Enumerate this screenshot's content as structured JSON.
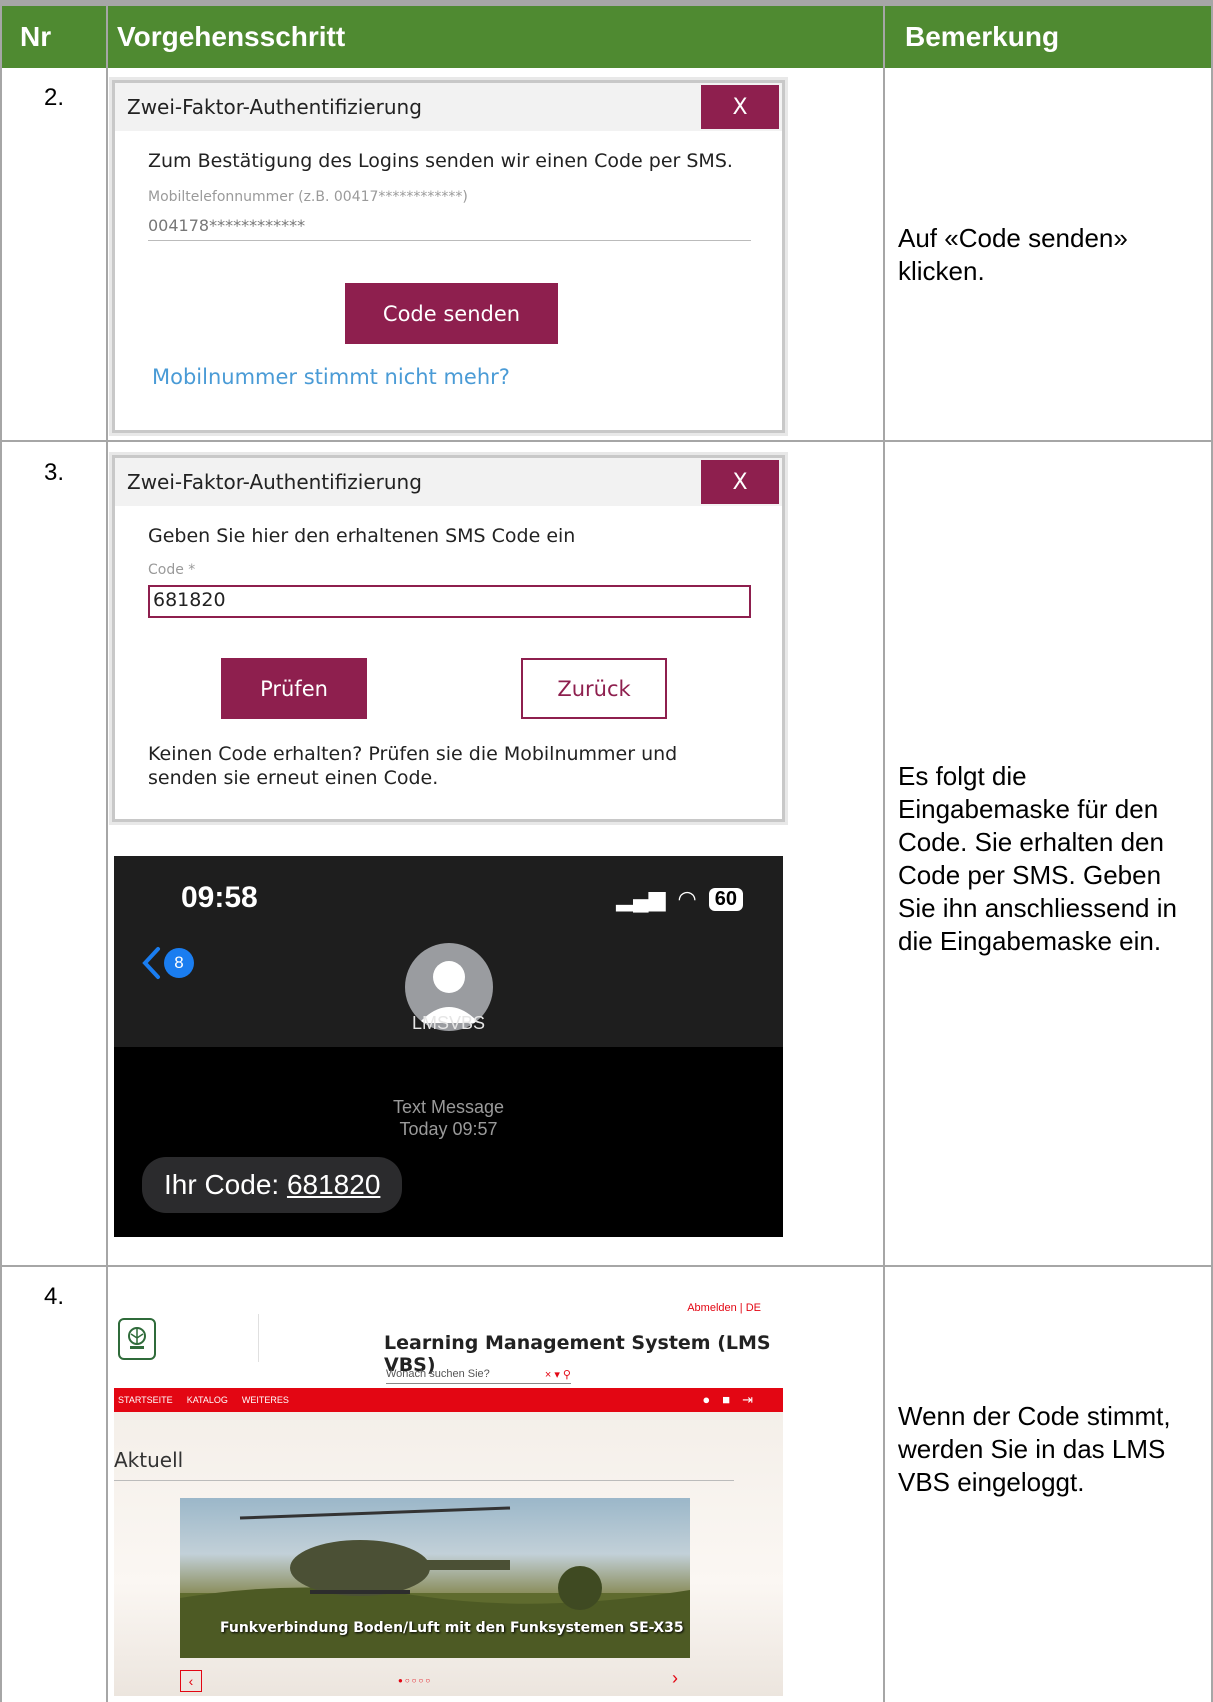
{
  "header": {
    "col_nr": "Nr",
    "col_step": "Vorgehensschritt",
    "col_remark": "Bemerkung"
  },
  "rows": [
    {
      "nr": "2.",
      "remark": "Auf «Code senden» klicken.",
      "dialog": {
        "title": "Zwei-Faktor-Authentifizierung",
        "close": "X",
        "text": "Zum Bestätigung des Logins senden wir einen Code per SMS.",
        "field_label": "Mobiltelefonnummer (z.B. 00417************)",
        "field_value": "004178************",
        "button": "Code senden",
        "link": "Mobilnummer stimmt nicht mehr?"
      }
    },
    {
      "nr": "3.",
      "remark": "Es folgt die Eingabemaske für den Code. Sie erhalten den Code per SMS. Geben Sie ihn anschliessend in die Eingabemaske ein.",
      "dialog": {
        "title": "Zwei-Faktor-Authentifizierung",
        "close": "X",
        "text": "Geben Sie hier den erhaltenen SMS Code ein",
        "field_label": "Code *",
        "field_value": "681820",
        "button_primary": "Prüfen",
        "button_secondary": "Zurück",
        "hint_line1": "Keinen Code erhalten? Prüfen sie die Mobilnummer und",
        "hint_line2": "senden sie erneut einen Code."
      },
      "phone": {
        "time": "09:58",
        "battery": "60",
        "back_count": "8",
        "sender": "LMSVBS",
        "meta_line1": "Text Message",
        "meta_line2": "Today 09:57",
        "message_prefix": "Ihr Code: ",
        "message_code": "681820"
      }
    },
    {
      "nr": "4.",
      "remark": "Wenn der Code stimmt, werden Sie in das LMS VBS eingeloggt.",
      "lms": {
        "top_links": "Abmelden | DE",
        "title": "Learning Management System (LMS VBS)",
        "search_placeholder": "Wonach suchen Sie?",
        "nav": [
          "STARTSEITE",
          "KATALOG",
          "WEITERES"
        ],
        "section": "Aktuell",
        "banner": "Funkverbindung Boden/Luft mit den Funksystemen SE-X35"
      }
    }
  ],
  "colors": {
    "header_green": "#4f8a31",
    "accent": "#8e1f4e",
    "lms_red": "#e30613"
  }
}
